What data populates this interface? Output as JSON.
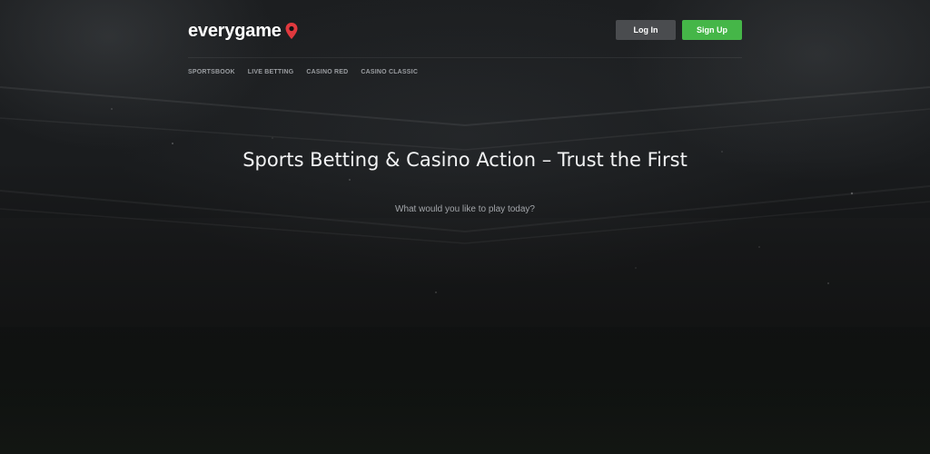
{
  "header": {
    "logo_text": "everygame",
    "login_label": "Log In",
    "signup_label": "Sign Up"
  },
  "nav": {
    "items": [
      {
        "label": "SPORTSBOOK"
      },
      {
        "label": "LIVE BETTING"
      },
      {
        "label": "CASINO RED"
      },
      {
        "label": "CASINO CLASSIC"
      }
    ]
  },
  "hero": {
    "title": "Sports Betting & Casino Action – Trust the First",
    "subtitle": "What would you like to play today?"
  },
  "colors": {
    "background": "#141516",
    "signup_button": "#45b648",
    "login_button": "#4a4c4f",
    "logo_pin": "#e0393e"
  },
  "icons": {
    "logo_pin": "map-pin-icon"
  }
}
